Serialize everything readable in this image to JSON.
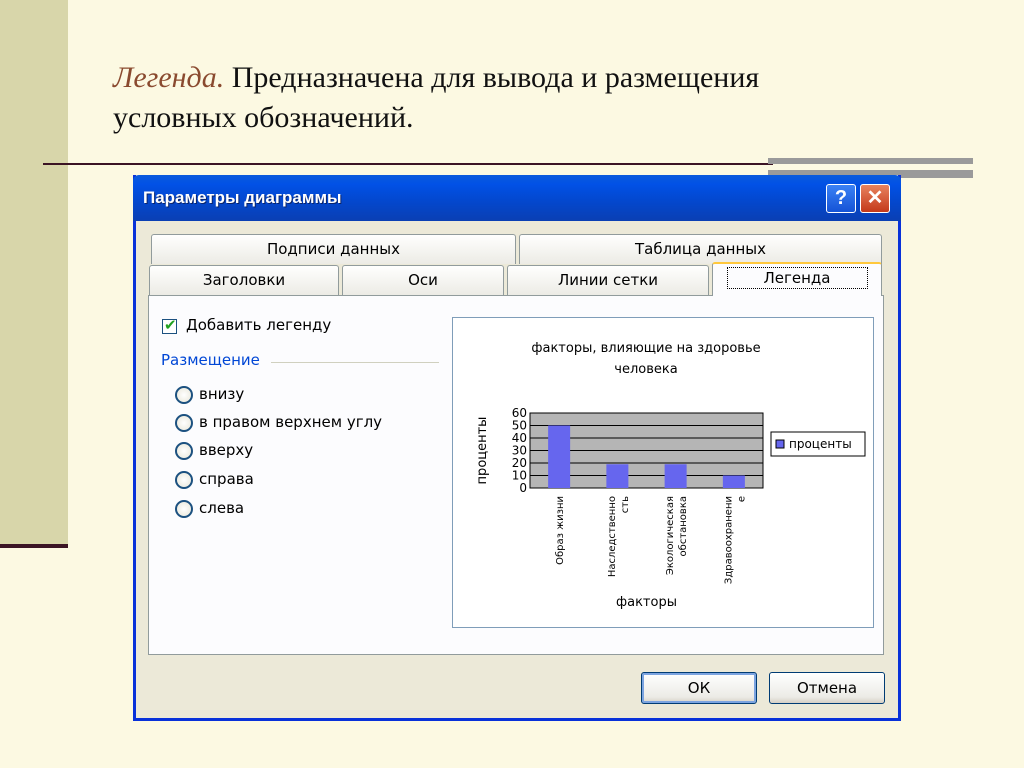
{
  "slide": {
    "term": "Легенда.",
    "description_line1": " Предназначена для вывода и размещения",
    "description_line2": "условных обозначений."
  },
  "dialog": {
    "title": "Параметры диаграммы",
    "help_label": "?",
    "close_label": "✕",
    "tabs_row_back": [
      "Подписи данных",
      "Таблица данных"
    ],
    "tabs_row_front": [
      "Заголовки",
      "Оси",
      "Линии сетки",
      "Легенда"
    ],
    "active_tab": "Легенда",
    "show_legend": {
      "label": "Добавить легенду",
      "checked": true
    },
    "placement_group": "Размещение",
    "placement_options": [
      "внизу",
      "в правом верхнем углу",
      "вверху",
      "справа",
      "слева"
    ],
    "ok_label": "ОК",
    "cancel_label": "Отмена"
  },
  "chart_data": {
    "type": "bar",
    "title_line1": "факторы, влияющие на здоровье",
    "title_line2": "человека",
    "xlabel": "факторы",
    "ylabel": "проценты",
    "categories_lines": [
      [
        "Образ жизни"
      ],
      [
        "Наследственно",
        "сть"
      ],
      [
        "Экологическая",
        "обстановка"
      ],
      [
        "Здравоохранени",
        "е"
      ]
    ],
    "series": [
      {
        "name": "проценты",
        "values": [
          50,
          19,
          19,
          10
        ]
      }
    ],
    "ylim": [
      0,
      60
    ],
    "yticks": [
      "0",
      "10",
      "20",
      "30",
      "40",
      "50",
      "60"
    ],
    "grid": true,
    "legend_position": "right",
    "bar_color": "#6666ee",
    "plot_bg": "#b5b5b5"
  }
}
